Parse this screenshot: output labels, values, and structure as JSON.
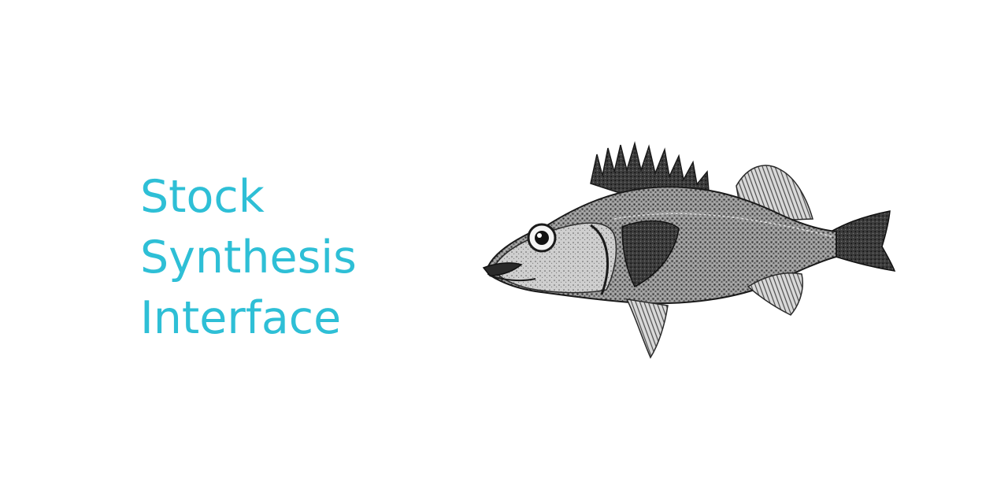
{
  "logo": {
    "title_lines": [
      "Stock",
      "Synthesis",
      "Interface"
    ],
    "title_color": "#2ebfd6",
    "illustration": "rockfish-engraving-icon",
    "illustration_colors": {
      "ink": "#1a1a1a",
      "mid": "#6f6f6f",
      "light": "#bdbdbd",
      "background": "#ffffff"
    }
  }
}
